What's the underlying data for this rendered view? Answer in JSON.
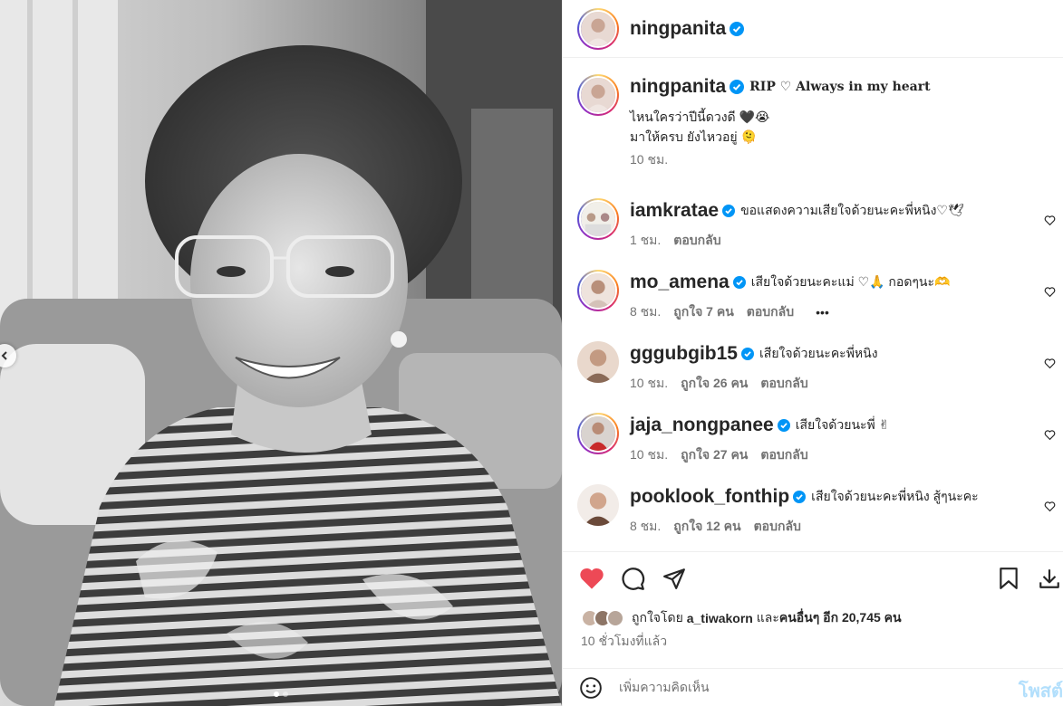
{
  "post": {
    "author": "ningpanita",
    "caption_title": "RIP ♡ Always in my heart",
    "caption_lines": [
      "ไหนใครว่าปีนี้ดวงดี 🖤😭",
      "มาให้ครบ ยังไหวอยู่ 🫠"
    ],
    "caption_time": "10 ชม."
  },
  "comments": [
    {
      "user": "iamkratae",
      "text": "ขอแสดงความเสียใจด้วยนะคะพี่หนิง♡🕊",
      "time": "1 ชม.",
      "likes": "",
      "reply": "ตอบกลับ",
      "ring": true
    },
    {
      "user": "mo_amena",
      "text": "เสียใจด้วยนะคะแม่ ♡🙏 กอดๆนะ🫶",
      "time": "8 ชม.",
      "likes": "ถูกใจ 7 คน",
      "reply": "ตอบกลับ",
      "ring": true,
      "more": "•••"
    },
    {
      "user": "gggubgib15",
      "text": "เสียใจด้วยนะคะพี่หนิง",
      "time": "10 ชม.",
      "likes": "ถูกใจ 26 คน",
      "reply": "ตอบกลับ",
      "ring": false
    },
    {
      "user": "jaja_nongpanee",
      "text": "เสียใจด้วยนะพี่ ✌",
      "time": "10 ชม.",
      "likes": "ถูกใจ 27 คน",
      "reply": "ตอบกลับ",
      "ring": true
    },
    {
      "user": "pooklook_fonthip",
      "text": "เสียใจด้วยนะคะพี่หนิง สู้ๆนะคะ",
      "time": "8 ชม.",
      "likes": "ถูกใจ 12 คน",
      "reply": "ตอบกลับ",
      "ring": false
    }
  ],
  "likes": {
    "prefix": "ถูกใจโดย",
    "user": "a_tiwakorn",
    "and": "และ",
    "others": "คนอื่นๆ อีก 20,745 คน"
  },
  "time_ago": "10 ชั่วโมงที่แล้ว",
  "add_comment": {
    "placeholder": "เพิ่มความคิดเห็น",
    "post_label": "โพสต์"
  },
  "colors": {
    "like_red": "#ed4956",
    "verified_blue": "#0095f6",
    "post_disabled": "#b2dffc"
  },
  "icons": [
    "heart-filled-icon",
    "comment-icon",
    "share-icon",
    "bookmark-icon",
    "download-icon",
    "emoji-icon",
    "verified-icon",
    "heart-outline-icon"
  ]
}
